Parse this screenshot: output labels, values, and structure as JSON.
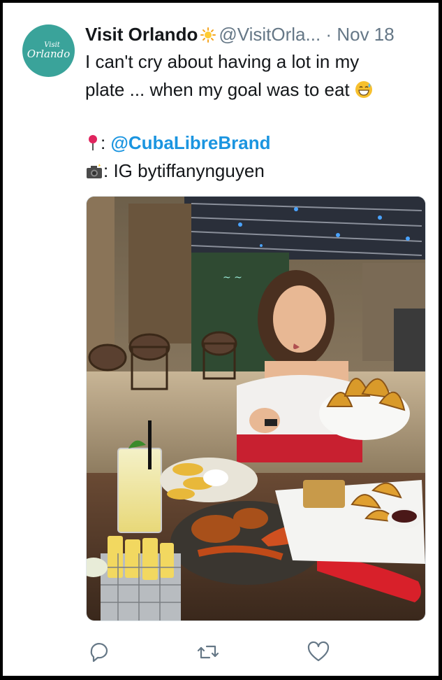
{
  "tweet": {
    "avatar": {
      "line1": "Visit",
      "line2": "Orlando"
    },
    "author_name": "Visit Orlando",
    "badge_icon": "sun-emoji",
    "handle": "@VisitOrla...",
    "separator": "·",
    "date": "Nov 18",
    "text_line1": "I can't cry about having a lot in my",
    "text_line2": "plate ... when my goal was to eat",
    "location_sep": ":",
    "location_mention": "@CubaLibreBrand",
    "camera_text": ": IG bytiffanynguyen"
  },
  "actions": [
    {
      "name": "reply",
      "icon": "reply-icon"
    },
    {
      "name": "retweet",
      "icon": "retweet-icon"
    },
    {
      "name": "like",
      "icon": "heart-icon"
    }
  ],
  "colors": {
    "link": "#1b95e0",
    "text": "#14171a",
    "muted": "#657786",
    "avatar_bg": "#3aa39a"
  }
}
